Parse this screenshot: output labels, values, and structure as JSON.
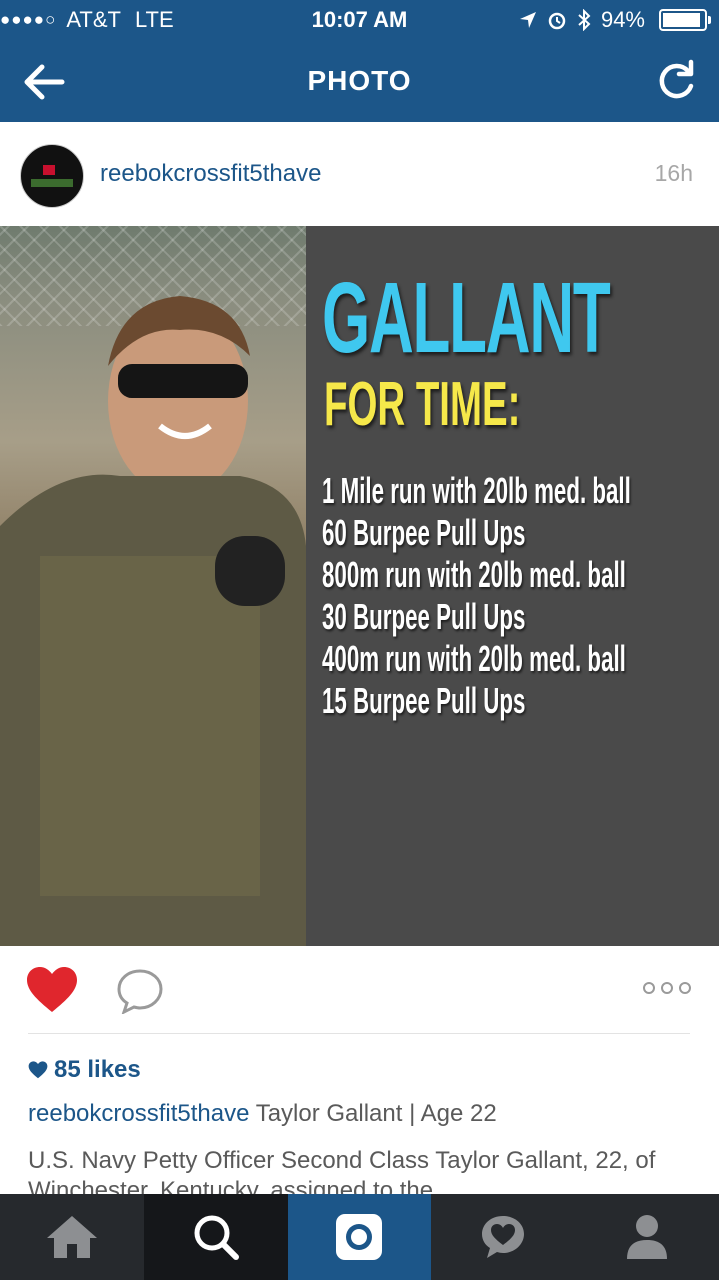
{
  "status": {
    "carrier": "AT&T",
    "network": "LTE",
    "time": "10:07 AM",
    "battery": "94%",
    "battery_level": 0.94
  },
  "nav": {
    "title": "PHOTO"
  },
  "post": {
    "username": "reebokcrossfit5thave",
    "time_ago": "16h",
    "image": {
      "headline": "GALLANT",
      "subhead": "FOR TIME:",
      "workout": [
        "1 Mile run with 20lb med. ball",
        "60 Burpee Pull Ups",
        "800m run with 20lb med. ball",
        "30 Burpee Pull Ups",
        "400m run with 20lb med. ball",
        "15 Burpee Pull Ups"
      ]
    },
    "likes": "85 likes",
    "caption_user": "reebokcrossfit5thave",
    "caption_text": "Taylor Gallant | Age 22",
    "description": "U.S. Navy Petty Officer Second Class Taylor Gallant, 22, of Winchester, Kentucky, assigned to the"
  },
  "tabs": [
    "home",
    "search",
    "camera",
    "activity",
    "profile"
  ],
  "colors": {
    "brand": "#1c5689",
    "like": "#e0262d",
    "headline": "#3fc8ef",
    "subhead": "#f6e84a"
  }
}
